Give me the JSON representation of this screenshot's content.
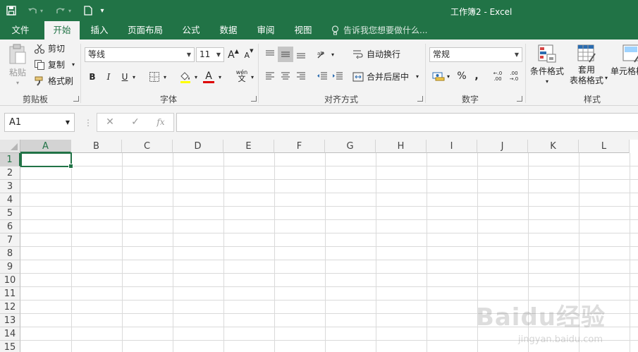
{
  "window": {
    "title": "工作簿2 - Excel"
  },
  "quick_access": {
    "save_icon": "save-icon",
    "undo_icon": "undo-icon",
    "redo_icon": "redo-icon",
    "new_icon": "new-document-icon",
    "customize_icon": "customize-qat-icon"
  },
  "tabs": [
    {
      "label": "文件",
      "active": false
    },
    {
      "label": "开始",
      "active": true
    },
    {
      "label": "插入",
      "active": false
    },
    {
      "label": "页面布局",
      "active": false
    },
    {
      "label": "公式",
      "active": false
    },
    {
      "label": "数据",
      "active": false
    },
    {
      "label": "审阅",
      "active": false
    },
    {
      "label": "视图",
      "active": false
    }
  ],
  "tellme": {
    "placeholder": "告诉我您想要做什么..."
  },
  "ribbon": {
    "clipboard": {
      "paste": "粘贴",
      "cut": "剪切",
      "copy": "复制",
      "format_painter": "格式刷",
      "label": "剪贴板"
    },
    "font": {
      "font_name": "等线",
      "font_size": "11",
      "grow": "A",
      "shrink": "A",
      "bold": "B",
      "italic": "I",
      "underline": "U",
      "font_color_glyph": "A",
      "phonetic": "wén",
      "label": "字体"
    },
    "alignment": {
      "wrap_text": "自动换行",
      "merge_center": "合并后居中",
      "label": "对齐方式"
    },
    "number": {
      "format": "常规",
      "percent": "%",
      "comma": ",",
      "label": "数字",
      "inc_dec_1": "←.0\n.00",
      "inc_dec_2": ".00\n→.0"
    },
    "styles": {
      "conditional": "条件格式",
      "table_line1": "套用",
      "table_line2": "表格格式",
      "cell_styles": "单元格样",
      "label": "样式"
    }
  },
  "formula_bar": {
    "name_box": "A1",
    "cancel": "✕",
    "enter": "✓",
    "fx": "fx",
    "value": ""
  },
  "sheet": {
    "columns": [
      "A",
      "B",
      "C",
      "D",
      "E",
      "F",
      "G",
      "H",
      "I",
      "J",
      "K",
      "L"
    ],
    "rows": [
      "1",
      "2",
      "3",
      "4",
      "5",
      "6",
      "7",
      "8",
      "9",
      "10",
      "11",
      "12",
      "13",
      "14",
      "15"
    ],
    "active_cell": "A1"
  },
  "watermark": {
    "logo_text": "Baidu经验",
    "url": "jingyan.baidu.com"
  },
  "colors": {
    "accent": "#217346",
    "ribbon_bg": "#f3f3f3",
    "grid_line": "#dadada"
  }
}
